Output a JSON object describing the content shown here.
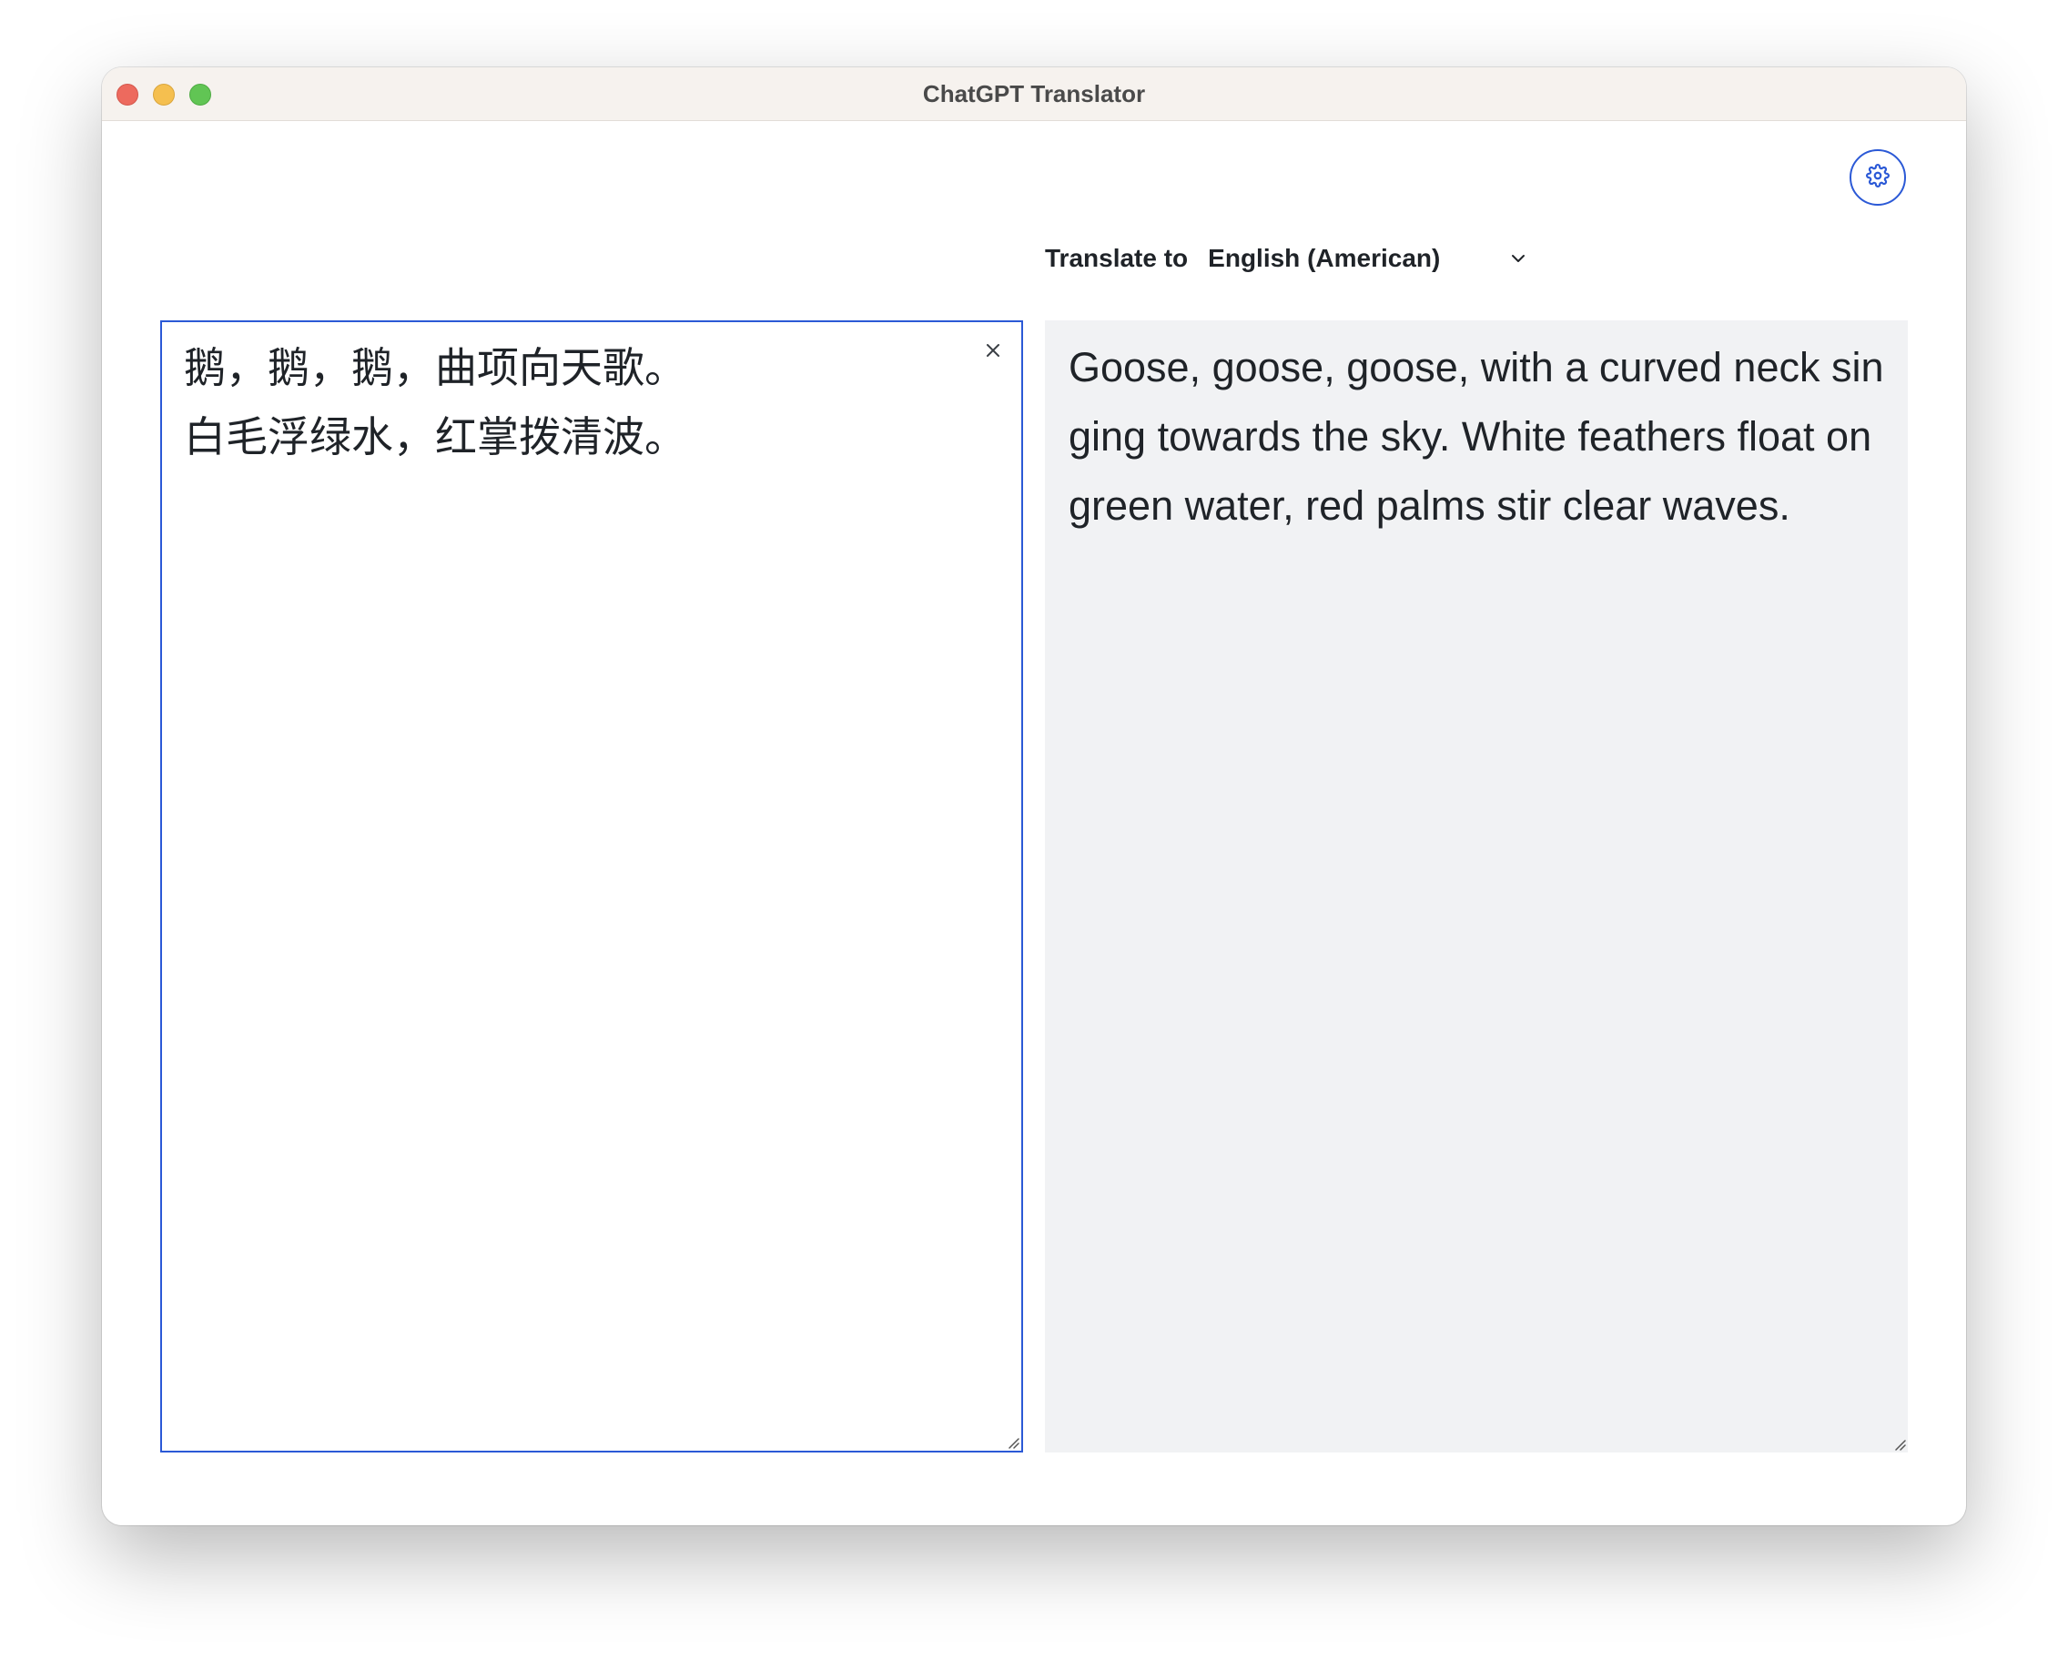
{
  "window": {
    "title": "ChatGPT Translator"
  },
  "toolbar": {
    "settings_icon": "gear-icon"
  },
  "language": {
    "label": "Translate to",
    "selected": "English (American)",
    "dropdown_icon": "chevron-down-icon"
  },
  "source": {
    "text": "鹅，鹅，鹅，曲项向天歌。\n白毛浮绿水，红掌拨清波。",
    "clear_icon": "close-icon"
  },
  "output": {
    "text": "Goose, goose, goose, with a curved neck singing towards the sky. White feathers float on green water, red palms stir clear waves."
  },
  "colors": {
    "accent": "#2b59d6",
    "output_background": "#f1f2f4",
    "titlebar": "#f6f2ee"
  }
}
